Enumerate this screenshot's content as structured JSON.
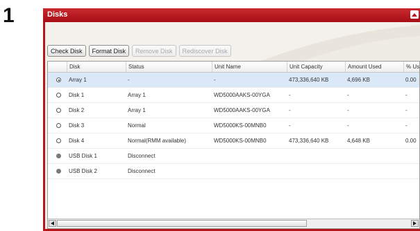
{
  "step_number": "1",
  "panel": {
    "title": "Disks"
  },
  "toolbar": {
    "buttons": [
      {
        "label": "Check Disk",
        "enabled": true
      },
      {
        "label": "Format Disk",
        "enabled": true
      },
      {
        "label": "Remove Disk",
        "enabled": false
      },
      {
        "label": "Rediscover Disk",
        "enabled": false
      }
    ]
  },
  "table": {
    "columns": [
      "Disk",
      "Status",
      "Unit Name",
      "Unit Capacity",
      "Amount Used",
      "% Us"
    ],
    "rows": [
      {
        "radio": "checked",
        "selected": true,
        "cells": [
          "Array 1",
          "-",
          "-",
          "473,336,640 KB",
          "4,696 KB",
          "0.00 "
        ]
      },
      {
        "radio": "unchecked",
        "selected": false,
        "cells": [
          "Disk 1",
          "Array 1",
          "WD5000AAKS-00YGA",
          "-",
          "-",
          "-"
        ]
      },
      {
        "radio": "unchecked",
        "selected": false,
        "cells": [
          "Disk 2",
          "Array 1",
          "WD5000AAKS-00YGA",
          "-",
          "-",
          "-"
        ]
      },
      {
        "radio": "unchecked",
        "selected": false,
        "cells": [
          "Disk 3",
          "Normal",
          "WD5000KS-00MNB0",
          "-",
          "-",
          "-"
        ]
      },
      {
        "radio": "unchecked",
        "selected": false,
        "cells": [
          "Disk 4",
          "Normal(RMM available)",
          "WD5000KS-00MNB0",
          "473,336,640 KB",
          "4,648 KB",
          "0.00 "
        ]
      },
      {
        "radio": "disabled",
        "selected": false,
        "cells": [
          "USB Disk 1",
          "Disconnect",
          "",
          "",
          "",
          ""
        ]
      },
      {
        "radio": "disabled",
        "selected": false,
        "cells": [
          "USB Disk 2",
          "Disconnect",
          "",
          "",
          "",
          ""
        ]
      }
    ]
  },
  "colors": {
    "header_red": "#b5151b",
    "selected_row": "#dbe8f8",
    "panel_bg": "#f3f1ec"
  },
  "icons": {
    "collapse": "collapse-up-icon",
    "scroll_left": "arrow-left-icon",
    "scroll_right": "arrow-right-icon"
  }
}
